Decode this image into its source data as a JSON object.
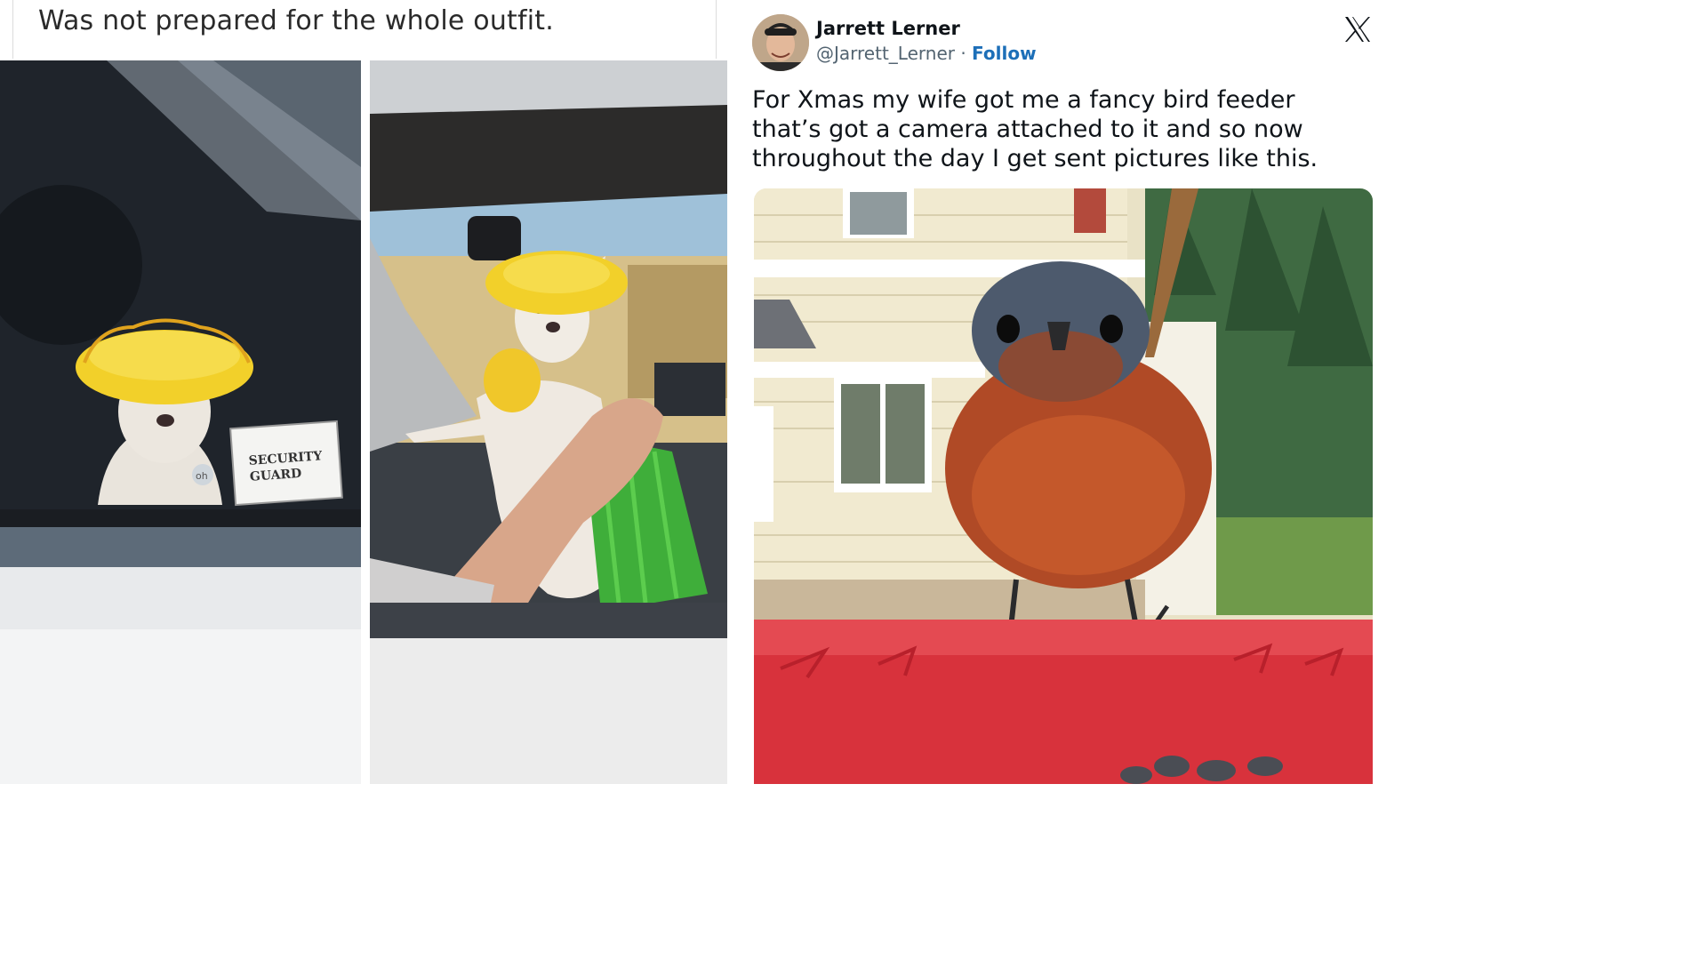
{
  "left_post": {
    "caption": "Was not prepared for the whole outfit.",
    "photo1": {
      "sticker_line1": "SECURITY",
      "sticker_line2": "GUARD",
      "badge": "oh"
    }
  },
  "tweet": {
    "display_name": "Jarrett Lerner",
    "handle": "@Jarrett_Lerner",
    "separator": " · ",
    "follow_label": "Follow",
    "platform_icon": "x-logo-icon",
    "text_lines": [
      "For Xmas my wife got me a fancy bird feeder",
      "that’s got a camera attached to it and so now",
      "throughout the day I get sent pictures like this."
    ]
  },
  "colors": {
    "follow_blue": "#1d6fb8",
    "feeder_red": "#d8323c",
    "hat_yellow": "#f2d02a",
    "skirt_green": "#3fae3a"
  }
}
